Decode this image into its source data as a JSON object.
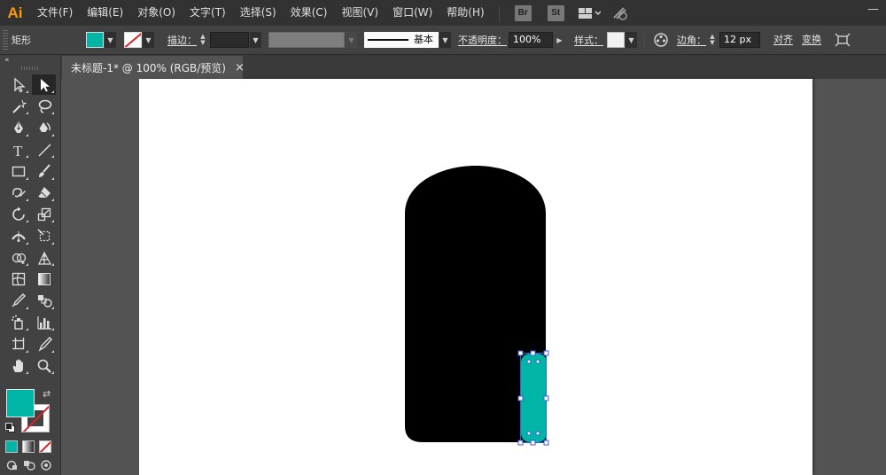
{
  "app": {
    "logo": "Ai",
    "menu": [
      "文件(F)",
      "编辑(E)",
      "对象(O)",
      "文字(T)",
      "选择(S)",
      "效果(C)",
      "视图(V)",
      "窗口(W)",
      "帮助(H)"
    ],
    "bridge_label": "Br",
    "stock_label": "St"
  },
  "control_bar": {
    "object_type": "矩形",
    "stroke_label": "描边：",
    "stroke_value": "",
    "brush_profile": "基本",
    "opacity_label": "不透明度：",
    "opacity_value": "100%",
    "style_label": "样式：",
    "corner_label": "边角：",
    "corner_value": "12 px",
    "align_label": "对齐",
    "transform_label": "变换",
    "fill_color": "#00b5a5",
    "stroke_color": "none"
  },
  "document": {
    "tab_title": "未标题-1* @ 100% (RGB/预览)",
    "close_glyph": "×"
  },
  "toolbox": {
    "collapse_glyph": "«",
    "fill_color": "#00b5a5",
    "tools": [
      [
        "selection-tool",
        "direct-selection-tool"
      ],
      [
        "magic-wand-tool",
        "lasso-tool"
      ],
      [
        "pen-tool",
        "curvature-tool"
      ],
      [
        "type-tool",
        "line-segment-tool"
      ],
      [
        "rectangle-tool",
        "paintbrush-tool"
      ],
      [
        "shaper-tool",
        "eraser-tool"
      ],
      [
        "rotate-tool",
        "scale-tool"
      ],
      [
        "width-tool",
        "free-transform-tool"
      ],
      [
        "shape-builder-tool",
        "perspective-grid-tool"
      ],
      [
        "mesh-tool",
        "gradient-tool"
      ],
      [
        "eyedropper-tool",
        "blend-tool"
      ],
      [
        "symbol-sprayer-tool",
        "column-graph-tool"
      ],
      [
        "artboard-tool",
        "slice-tool"
      ],
      [
        "hand-tool",
        "zoom-tool"
      ]
    ],
    "active_tool": "direct-selection-tool"
  },
  "artboard": {
    "shapes": [
      {
        "name": "black-arched-shape",
        "fill": "#000000"
      },
      {
        "name": "teal-rounded-rectangle",
        "fill": "#00b5a5",
        "selected": true
      }
    ],
    "selection_color": "#3b5bdb"
  }
}
